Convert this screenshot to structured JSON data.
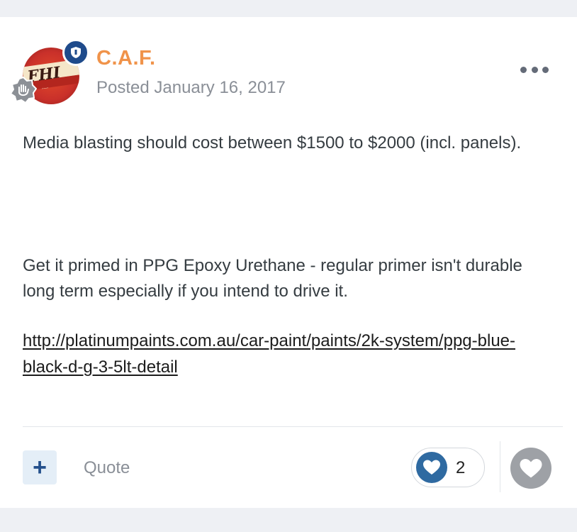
{
  "author": {
    "name": "C.A.F.",
    "posted": "Posted January 16, 2017"
  },
  "post": {
    "paragraph1": "Media blasting should cost between $1500 to $2000 (incl. panels).",
    "paragraph2": "Get it primed in PPG Epoxy Urethane - regular primer isn't durable long term especially if you intend to drive it.",
    "link": "http://platinumpaints.com.au/car-paint/paints/2k-system/ppg-blue-black-d-g-3-5lt-detail"
  },
  "actions": {
    "quote_label": "Quote",
    "multiquote_label": "+",
    "reaction_count": "2"
  },
  "colors": {
    "author_name": "#f0934a",
    "badge": "#1f4b8b",
    "reaction": "#2f6aa1"
  },
  "icons": {
    "rank": "shield-icon",
    "reputation": "hand-icon",
    "more": "ellipsis-icon",
    "reaction": "heart-icon",
    "like": "heart-icon"
  }
}
